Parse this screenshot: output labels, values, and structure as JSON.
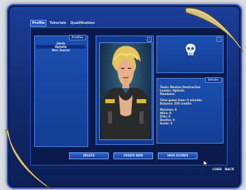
{
  "window": {
    "title": ""
  },
  "tabs": [
    {
      "label": "Profile",
      "active": true
    },
    {
      "label": "Tutorials"
    },
    {
      "label": "Qualification"
    }
  ],
  "profiles": {
    "header": "Profiles",
    "items": [
      {
        "name": "Jakob",
        "selected": false
      },
      {
        "name": "Ophelia",
        "selected": true
      },
      {
        "name": "War_Tourist",
        "selected": false
      }
    ]
  },
  "details": {
    "header": "Details",
    "team": "Team: Weston Destruction",
    "leader": "Leader: Ophelia",
    "members": "Members:",
    "game_time": "Total game time: 0 minutes",
    "balance": "Balance: 250 credits",
    "matches": "Matches: 0",
    "wins": "Wins: 0",
    "kills": "Kills: 0",
    "deaths": "Deaths: 0",
    "goals": "Goals: 0"
  },
  "buttons": {
    "delete": "DELETE",
    "create_new": "CREATE NEW",
    "high_scores": "HIGH SCORES",
    "load": "LOAD",
    "back": "BACK"
  },
  "colors": {
    "frame": "#1b3e9a",
    "panel": "#1b4fb0",
    "text_gold": "#f3e7b0",
    "accent": "#4c86e8"
  },
  "icons": {
    "team_logo": "skull-icon",
    "close": "close-icon"
  }
}
